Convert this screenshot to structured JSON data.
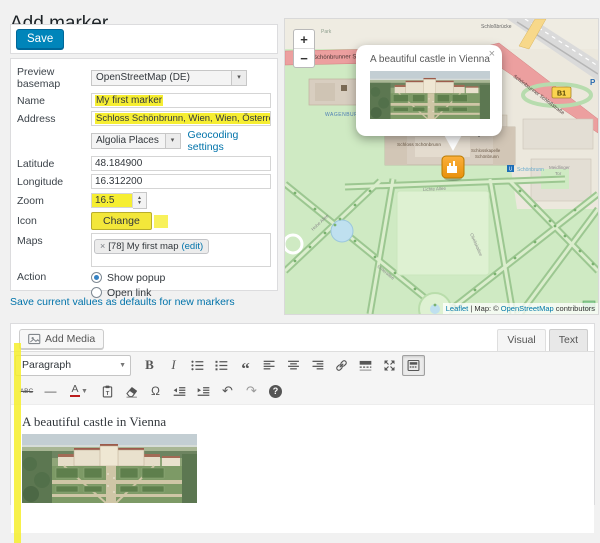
{
  "page": {
    "title": "Add marker"
  },
  "toolbar": {
    "save_label": "Save"
  },
  "colors": {
    "accent": "#0085ba",
    "link": "#0073aa",
    "highlight": "#f6ee32",
    "marker": "#f0a02e"
  },
  "form": {
    "basemap": {
      "label": "Preview basemap",
      "value": "OpenStreetMap (DE)"
    },
    "name": {
      "label": "Name",
      "value": "My first marker"
    },
    "address": {
      "label": "Address",
      "value": "Schloss Schönbrunn, Wien, Wien, Österreich"
    },
    "geocoder": {
      "value": "Algolia Places",
      "settings_link": "Geocoding settings"
    },
    "latitude": {
      "label": "Latitude",
      "value": "48.184900"
    },
    "longitude": {
      "label": "Longitude",
      "value": "16.312200"
    },
    "zoom": {
      "label": "Zoom",
      "value": "16.5"
    },
    "icon": {
      "label": "Icon",
      "button": "Change"
    },
    "maps": {
      "label": "Maps",
      "remove": "×",
      "tag": "[78] My first map",
      "edit_link": "(edit)"
    },
    "action": {
      "label": "Action",
      "option1": "Show popup",
      "option2": "Open link"
    },
    "defaults_link": "Save current values as defaults for new markers"
  },
  "map": {
    "zoom_in": "+",
    "zoom_out": "−",
    "popup": {
      "title": "A beautiful castle in Vienna",
      "close": "×"
    },
    "route_badge": "B1",
    "parking": "P",
    "labels": {
      "road_top": "Schönbrunner Schloßstraße",
      "road_right": "Schönbrunner Schloßstraße",
      "bridge": "Schloßbrücke",
      "park": "Park",
      "wagenburg": "WAGENBURG",
      "palace": "Schloss Schönbrunn",
      "chapel1": "Schlosskapelle",
      "chapel2": "Schönbrunn",
      "station": "Schönbrunn",
      "tor1": "Meidlinger",
      "tor2": "Tor",
      "allee1": "Lichte Allee",
      "allee2": "Obeliskallee",
      "allee3": "Unterallee",
      "allee4": "Hohe Allee"
    },
    "attribution": {
      "leaflet": "Leaflet",
      "sep": " | Map: © ",
      "osm": "OpenStreetMap",
      "suffix": " contributors"
    }
  },
  "editor": {
    "add_media": "Add Media",
    "tabs": {
      "visual": "Visual",
      "text": "Text"
    },
    "toolbar": {
      "paragraph": "Paragraph",
      "bold": "B",
      "italic": "I",
      "blockquote": "“",
      "strikethrough": "ABC",
      "hr": "—",
      "text_color": "A",
      "special_char": "Ω",
      "undo": "↶",
      "redo": "↷",
      "help": "?"
    },
    "content": {
      "heading": "A beautiful castle in Vienna"
    }
  }
}
